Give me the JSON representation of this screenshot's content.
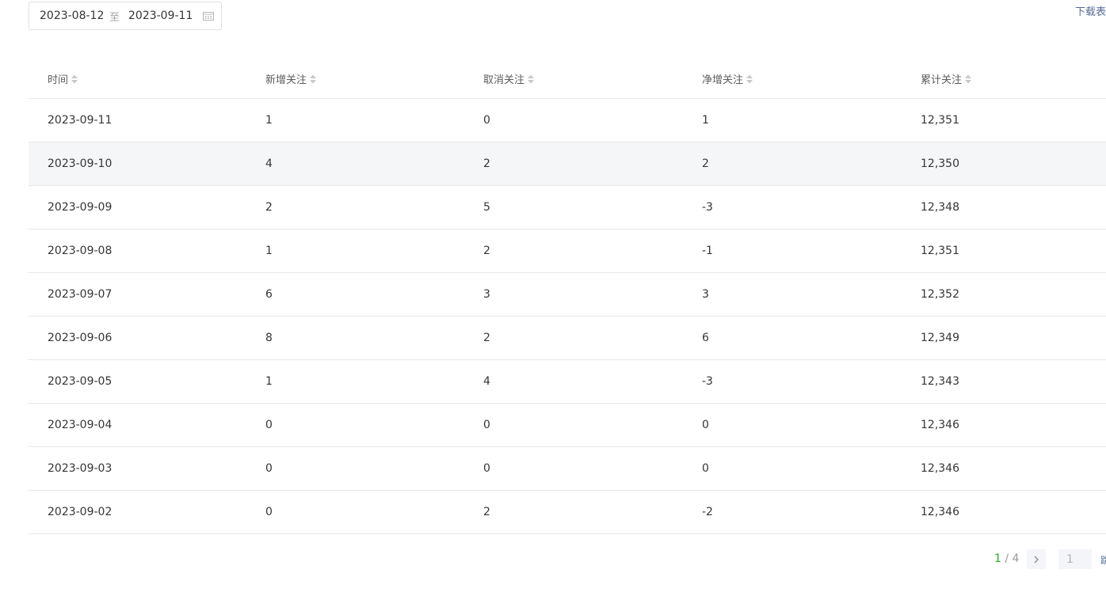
{
  "date_filter": {
    "start": "2023-08-12",
    "separator": "至",
    "end": "2023-09-11"
  },
  "download_label": "下载表",
  "table": {
    "columns": [
      "时间",
      "新增关注",
      "取消关注",
      "净增关注",
      "累计关注"
    ],
    "rows": [
      [
        "2023-09-11",
        "1",
        "0",
        "1",
        "12,351"
      ],
      [
        "2023-09-10",
        "4",
        "2",
        "2",
        "12,350"
      ],
      [
        "2023-09-09",
        "2",
        "5",
        "-3",
        "12,348"
      ],
      [
        "2023-09-08",
        "1",
        "2",
        "-1",
        "12,351"
      ],
      [
        "2023-09-07",
        "6",
        "3",
        "3",
        "12,352"
      ],
      [
        "2023-09-06",
        "8",
        "2",
        "6",
        "12,349"
      ],
      [
        "2023-09-05",
        "1",
        "4",
        "-3",
        "12,343"
      ],
      [
        "2023-09-04",
        "0",
        "0",
        "0",
        "12,346"
      ],
      [
        "2023-09-03",
        "0",
        "0",
        "0",
        "12,346"
      ],
      [
        "2023-09-02",
        "0",
        "2",
        "-2",
        "12,346"
      ]
    ]
  },
  "pagination": {
    "current": "1",
    "total_text": " / 4",
    "jump_placeholder": "1",
    "jump_label": "跳"
  },
  "colors": {
    "accent_green": "#1aad19",
    "link": "#576b95"
  }
}
